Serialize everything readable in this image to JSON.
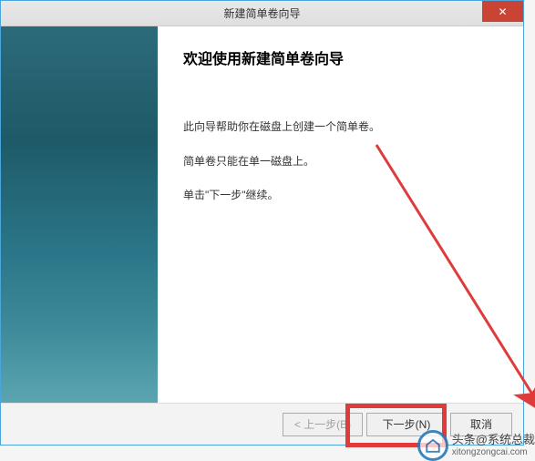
{
  "titlebar": {
    "title": "新建简单卷向导"
  },
  "main": {
    "heading": "欢迎使用新建简单卷向导",
    "para1": "此向导帮助你在磁盘上创建一个简单卷。",
    "para2": "简单卷只能在单一磁盘上。",
    "para3": "单击\"下一步\"继续。"
  },
  "buttons": {
    "back": "< 上一步(B)",
    "next": "下一步(N)",
    "cancel": "取消"
  },
  "watermark": {
    "brand": "头条@系统总裁",
    "sub": "xitongzongcai.com"
  }
}
